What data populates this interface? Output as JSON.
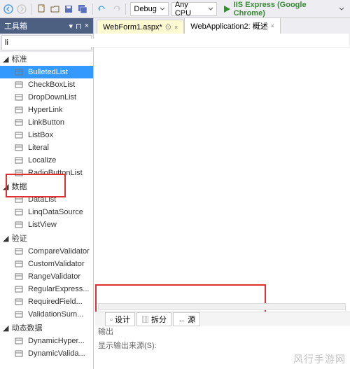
{
  "toolbar": {
    "config_debug": "Debug",
    "platform": "Any CPU",
    "run_label": "IIS Express (Google Chrome)"
  },
  "toolbox": {
    "title": "工具箱",
    "search_value": "li",
    "search_clear_icon": "clear-icon",
    "categories": [
      {
        "label": "标准",
        "items": [
          "BulletedList",
          "CheckBoxList",
          "DropDownList",
          "HyperLink",
          "LinkButton",
          "ListBox",
          "Literal",
          "Localize",
          "RadioButtonList"
        ]
      },
      {
        "label": "数据",
        "items": [
          "DataList",
          "LinqDataSource",
          "ListView"
        ]
      },
      {
        "label": "验证",
        "items": [
          "CompareValidator",
          "CustomValidator",
          "RangeValidator",
          "RegularExpress...",
          "RequiredField...",
          "ValidationSum..."
        ]
      },
      {
        "label": "动态数据",
        "items": [
          "DynamicHyper...",
          "DynamicValida..."
        ]
      }
    ],
    "selected_item": "BulletedList"
  },
  "tabs": [
    {
      "label": "WebForm1.aspx",
      "dirty": "*",
      "active": true
    },
    {
      "label": "WebApplication2: 概述",
      "dirty": "",
      "active": false
    }
  ],
  "view_switcher": {
    "design": "设计",
    "split": "拆分",
    "source": "源"
  },
  "output": {
    "label": "输出",
    "line": "显示输出来源(S):"
  },
  "watermark": "风行手游网"
}
